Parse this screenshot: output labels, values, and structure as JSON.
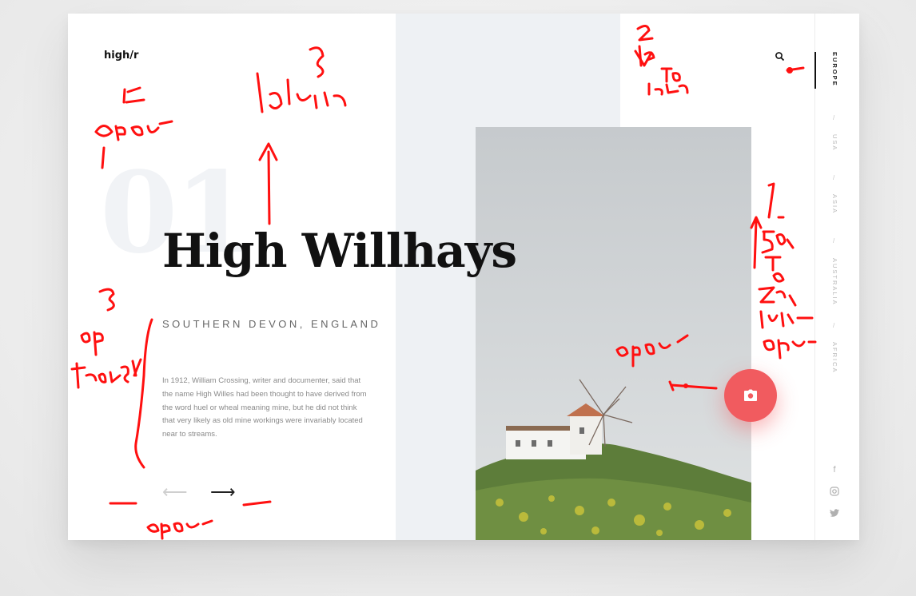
{
  "brand": {
    "logo": "high/r"
  },
  "slide": {
    "number": "01",
    "title": "High Willhays",
    "subtitle": "SOUTHERN DEVON, ENGLAND",
    "description": "In 1912, William Crossing, writer and documenter, said that the name High Willes had been thought to have derived from the word huel or wheal meaning mine, but he did not think that very likely as old mine workings were invariably located near to streams."
  },
  "navigation": {
    "prev": "⟵",
    "next": "⟶",
    "regions": [
      "EUROPE",
      "USA",
      "ASIA",
      "AUSTRALIA",
      "AFRICA"
    ],
    "active_region": "EUROPE",
    "separator": "/"
  },
  "icons": {
    "search": "search-icon",
    "camera": "camera-icon",
    "facebook": "facebook-icon",
    "instagram": "instagram-icon",
    "twitter": "twitter-icon"
  },
  "social": {
    "facebook": "f"
  },
  "annotations": [
    "6 opac",
    "3 blur in",
    "2. up. to. low",
    "1.",
    "50% to 100% blur opac",
    "3 op transy",
    "opac",
    "opac"
  ],
  "colors": {
    "accent": "#f15b5f",
    "annotation": "#ff1010",
    "panel": "#eef1f4",
    "title": "#111111"
  }
}
